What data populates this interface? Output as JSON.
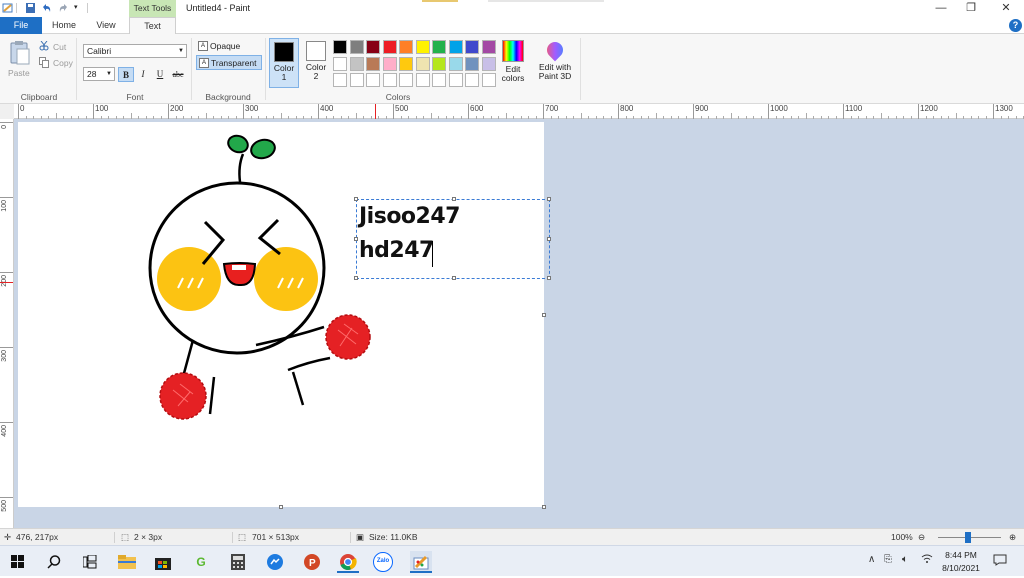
{
  "titlebar": {
    "context_tab": "Text Tools",
    "title": "Untitled4 - Paint",
    "icons": [
      "paint-app-icon",
      "save-icon",
      "undo-icon",
      "redo-icon",
      "customize-dropdown-icon"
    ],
    "controls": [
      "minimize-icon",
      "restore-icon",
      "close-icon"
    ]
  },
  "tabs": {
    "file": "File",
    "home": "Home",
    "view": "View",
    "text": "Text"
  },
  "ribbon": {
    "clipboard": {
      "label": "Clipboard",
      "paste": "Paste",
      "cut": "Cut",
      "copy": "Copy"
    },
    "font": {
      "label": "Font",
      "family": "Calibri",
      "size": "28",
      "bold": "B",
      "italic": "I",
      "underline": "U",
      "strike": "abc"
    },
    "background": {
      "label": "Background",
      "opaque": "Opaque",
      "transparent": "Transparent",
      "selected": "Transparent"
    },
    "colors": {
      "label": "Colors",
      "color1_label": "Color\n1",
      "color2_label": "Color\n2",
      "color1_value": "#000000",
      "color2_value": "#ffffff",
      "palette_row1": [
        "#000000",
        "#7f7f7f",
        "#880015",
        "#ed1c24",
        "#ff7f27",
        "#fff200",
        "#22b14c",
        "#00a2e8",
        "#3f48cc",
        "#a349a4"
      ],
      "palette_row2": [
        "#ffffff",
        "#c3c3c3",
        "#b97a57",
        "#ffaec9",
        "#ffc90e",
        "#efe4b0",
        "#b5e61d",
        "#99d9ea",
        "#7092be",
        "#c8bfe7"
      ],
      "palette_row3": [
        "#ffffff",
        "#ffffff",
        "#ffffff",
        "#ffffff",
        "#ffffff",
        "#ffffff",
        "#ffffff",
        "#ffffff",
        "#ffffff",
        "#ffffff"
      ],
      "edit_colors": "Edit\ncolors",
      "edit_3d": "Edit with\nPaint 3D"
    }
  },
  "ruler": {
    "h_ticks": [
      "0",
      "100",
      "200",
      "300",
      "400",
      "500",
      "600",
      "700",
      "800",
      "900",
      "1000",
      "1100",
      "1200",
      "1300"
    ],
    "v_ticks": [
      "0",
      "100",
      "200",
      "300",
      "400",
      "500"
    ]
  },
  "canvas": {
    "text_lines": [
      "Jisoo247",
      "hd247"
    ],
    "drawing": "cute cartoon character with sprout and red pom-poms"
  },
  "statusbar": {
    "cursor_pos": "476, 217px",
    "selection_size": "2 × 3px",
    "canvas_size": "701 × 513px",
    "file_size": "Size: 11.0KB",
    "zoom": "100%",
    "zoom_level": 0.5
  },
  "taskbar": {
    "apps": [
      "windows-start-icon",
      "search-icon",
      "task-view-icon",
      "file-explorer-icon",
      "store-icon",
      "app-icon",
      "calculator-icon",
      "messenger-icon",
      "powerpoint-icon",
      "chrome-icon",
      "zalo-icon",
      "paint-icon"
    ],
    "zalo_label": "Zalo",
    "time": "8:44 PM",
    "date": "8/10/2021"
  }
}
